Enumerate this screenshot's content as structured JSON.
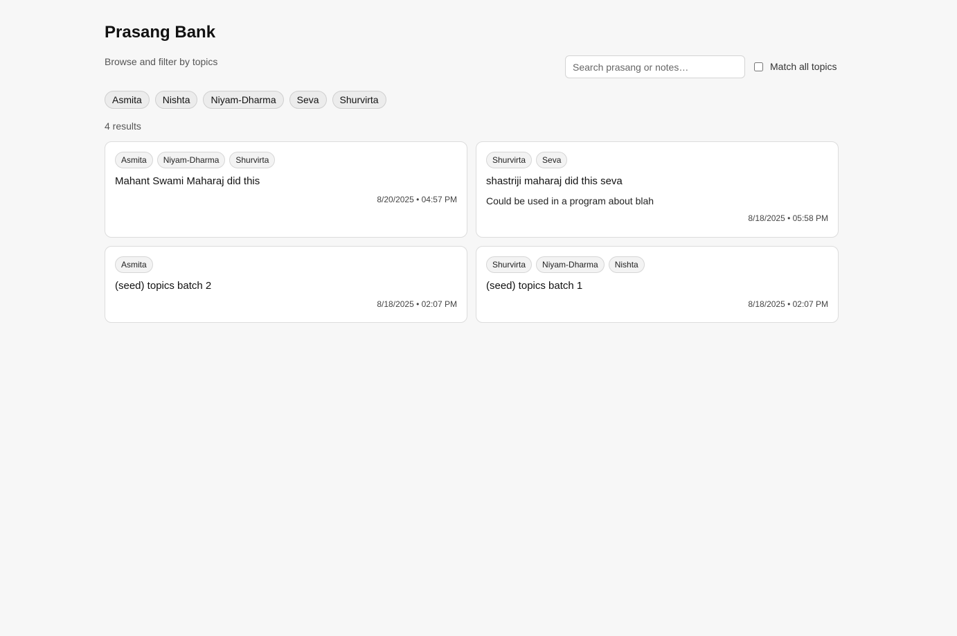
{
  "header": {
    "title": "Prasang Bank",
    "subtitle": "Browse and filter by topics"
  },
  "search": {
    "placeholder": "Search prasang or notes…",
    "value": ""
  },
  "match_all": {
    "label": "Match all topics",
    "checked": false
  },
  "filters": [
    "Asmita",
    "Nishta",
    "Niyam-Dharma",
    "Seva",
    "Shurvirta"
  ],
  "results_count": "4 results",
  "cards": [
    {
      "tags": [
        "Asmita",
        "Niyam-Dharma",
        "Shurvirta"
      ],
      "title": "Mahant Swami Maharaj did this",
      "notes": "",
      "date": "8/20/2025 • 04:57 PM"
    },
    {
      "tags": [
        "Shurvirta",
        "Seva"
      ],
      "title": "shastriji maharaj did this seva",
      "notes": "Could be used in a program about blah",
      "date": "8/18/2025 • 05:58 PM"
    },
    {
      "tags": [
        "Asmita"
      ],
      "title": "(seed) topics batch 2",
      "notes": "",
      "date": "8/18/2025 • 02:07 PM"
    },
    {
      "tags": [
        "Shurvirta",
        "Niyam-Dharma",
        "Nishta"
      ],
      "title": "(seed) topics batch 1",
      "notes": "",
      "date": "8/18/2025 • 02:07 PM"
    }
  ]
}
